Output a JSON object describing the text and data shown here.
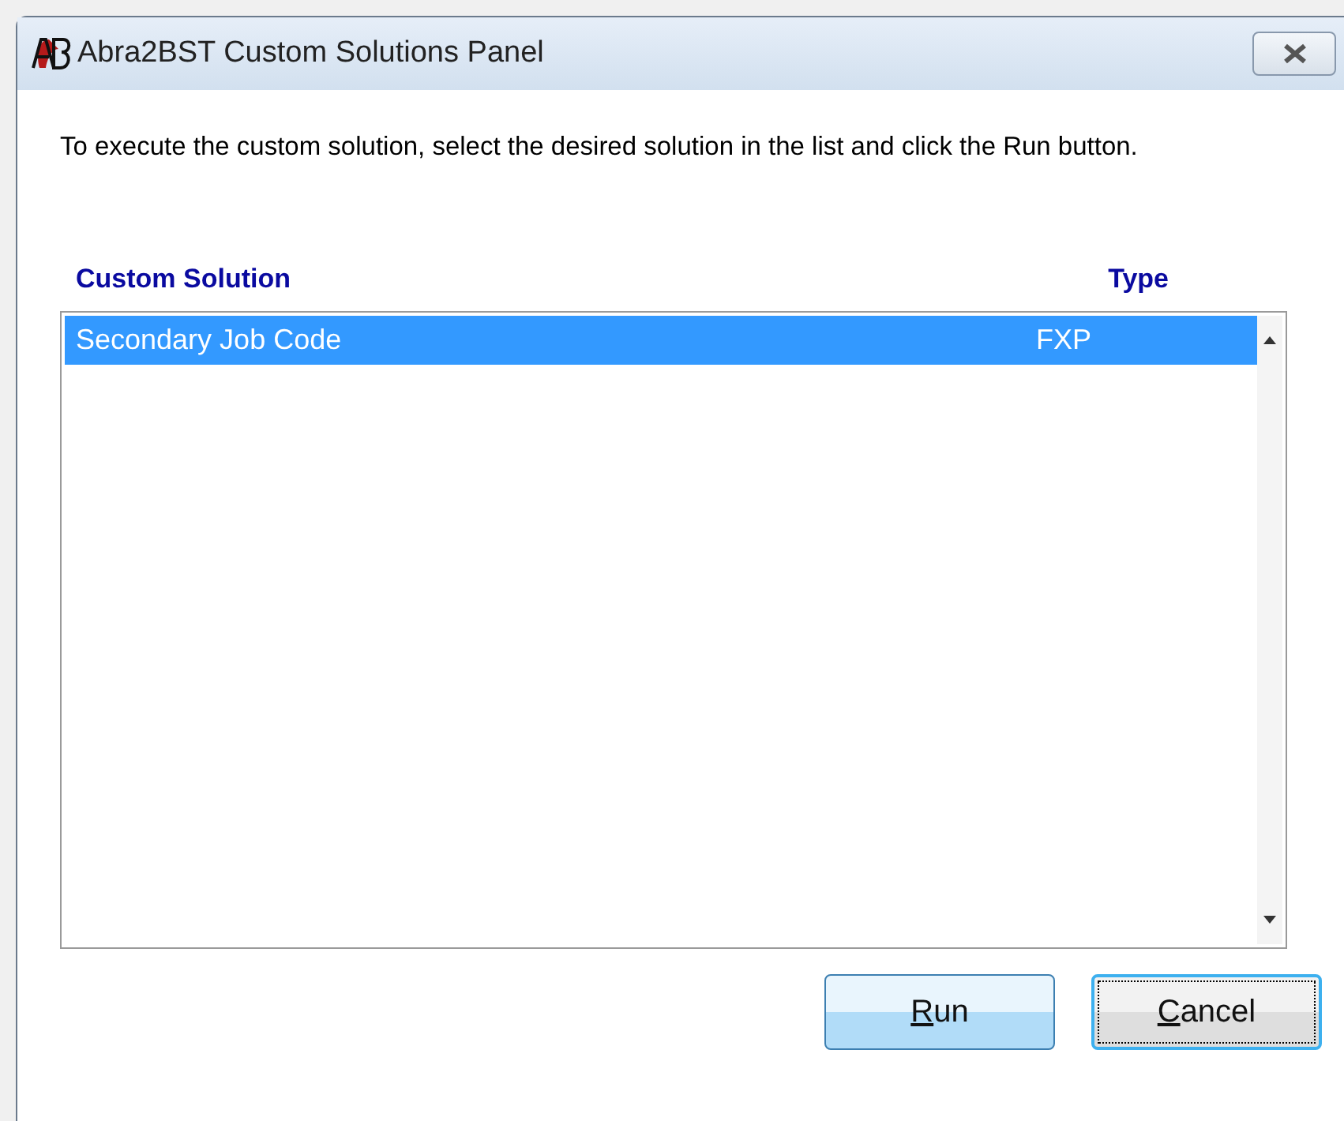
{
  "window": {
    "title": "Abra2BST Custom Solutions Panel"
  },
  "instructions": "To execute the custom solution, select the desired solution in the list and click the Run button.",
  "list": {
    "columns": [
      "Custom Solution",
      "Type"
    ],
    "rows": [
      {
        "name": "Secondary Job Code",
        "type": "FXP",
        "selected": true
      }
    ]
  },
  "buttons": [
    {
      "label": "Run",
      "focused": false
    },
    {
      "label": "Cancel",
      "focused": true
    }
  ]
}
